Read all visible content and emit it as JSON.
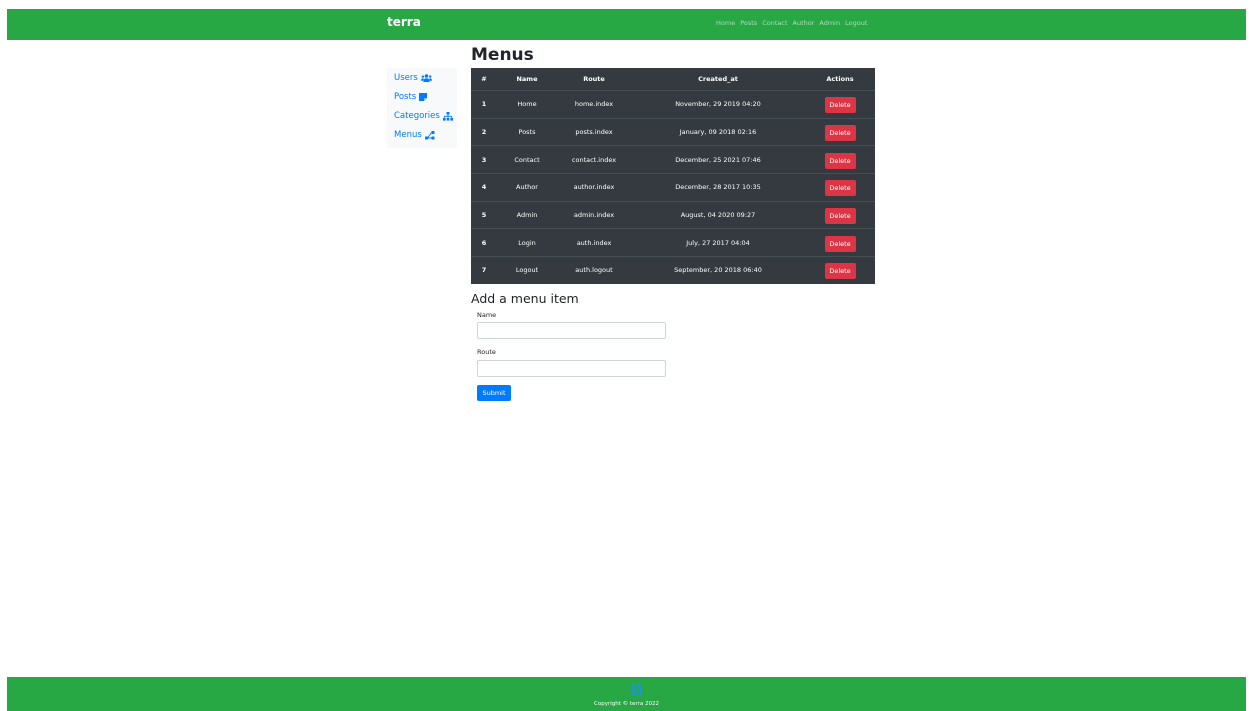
{
  "navbar": {
    "brand": "terra",
    "links": [
      "Home",
      "Posts",
      "Contact",
      "Author",
      "Admin",
      "Logout"
    ]
  },
  "sidebar": {
    "items": [
      {
        "label": "Users",
        "icon": "users-icon"
      },
      {
        "label": "Posts",
        "icon": "sticky-note-icon"
      },
      {
        "label": "Categories",
        "icon": "sitemap-icon"
      },
      {
        "label": "Menus",
        "icon": "menu-tree-icon"
      }
    ]
  },
  "page_title": "Menus",
  "table": {
    "headers": [
      "#",
      "Name",
      "Route",
      "Created_at",
      "Actions"
    ],
    "delete_label": "Delete",
    "rows": [
      {
        "id": "1",
        "name": "Home",
        "route": "home.index",
        "created_at": "November, 29 2019 04:20"
      },
      {
        "id": "2",
        "name": "Posts",
        "route": "posts.index",
        "created_at": "January, 09 2018 02:16"
      },
      {
        "id": "3",
        "name": "Contact",
        "route": "contact.index",
        "created_at": "December, 25 2021 07:46"
      },
      {
        "id": "4",
        "name": "Author",
        "route": "author.index",
        "created_at": "December, 28 2017 10:35"
      },
      {
        "id": "5",
        "name": "Admin",
        "route": "admin.index",
        "created_at": "August, 04 2020 09:27"
      },
      {
        "id": "6",
        "name": "Login",
        "route": "auth.index",
        "created_at": "July, 27 2017 04:04"
      },
      {
        "id": "7",
        "name": "Logout",
        "route": "auth.logout",
        "created_at": "September, 20 2018 06:40"
      }
    ]
  },
  "form": {
    "title": "Add a menu item",
    "name_label": "Name",
    "name_value": "",
    "route_label": "Route",
    "route_value": "",
    "submit_label": "Submit"
  },
  "footer": {
    "icon": "file-icon",
    "text": "Copyright © terra 2022"
  },
  "colors": {
    "brand_green": "#28a745",
    "table_dark": "#343a40",
    "danger": "#dc3545",
    "primary": "#007bff"
  }
}
